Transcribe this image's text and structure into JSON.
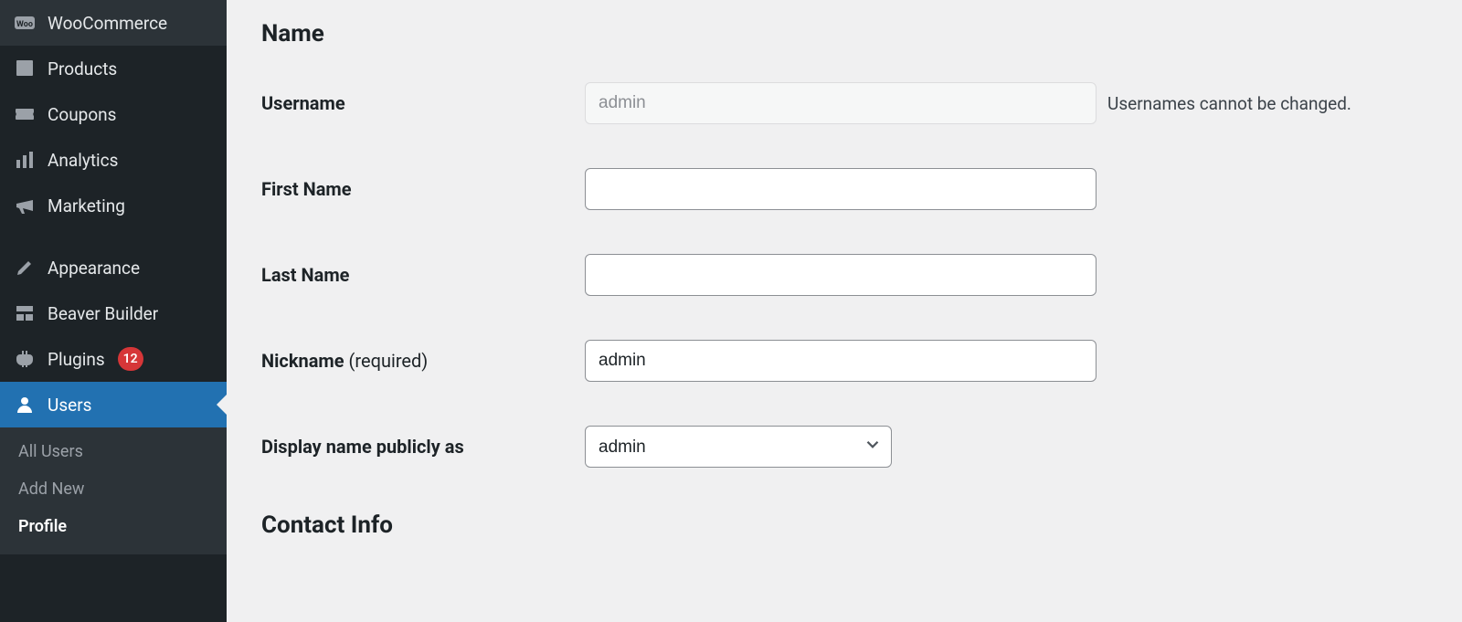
{
  "sidebar": {
    "items": [
      {
        "label": "WooCommerce",
        "icon": "woocommerce-icon"
      },
      {
        "label": "Products",
        "icon": "products-icon"
      },
      {
        "label": "Coupons",
        "icon": "coupons-icon"
      },
      {
        "label": "Analytics",
        "icon": "analytics-icon"
      },
      {
        "label": "Marketing",
        "icon": "marketing-icon"
      },
      {
        "label": "Appearance",
        "icon": "appearance-icon"
      },
      {
        "label": "Beaver Builder",
        "icon": "beaver-builder-icon"
      },
      {
        "label": "Plugins",
        "icon": "plugins-icon",
        "badge": "12"
      },
      {
        "label": "Users",
        "icon": "users-icon",
        "active": true
      }
    ],
    "submenu": {
      "items": [
        {
          "label": "All Users"
        },
        {
          "label": "Add New"
        },
        {
          "label": "Profile",
          "current": true
        }
      ]
    }
  },
  "main": {
    "section_name": "Name",
    "section_contact": "Contact Info",
    "username": {
      "label": "Username",
      "value": "admin",
      "help": "Usernames cannot be changed."
    },
    "first_name": {
      "label": "First Name",
      "value": ""
    },
    "last_name": {
      "label": "Last Name",
      "value": ""
    },
    "nickname": {
      "label": "Nickname",
      "required_text": "(required)",
      "value": "admin"
    },
    "display_name": {
      "label": "Display name publicly as",
      "value": "admin"
    }
  }
}
